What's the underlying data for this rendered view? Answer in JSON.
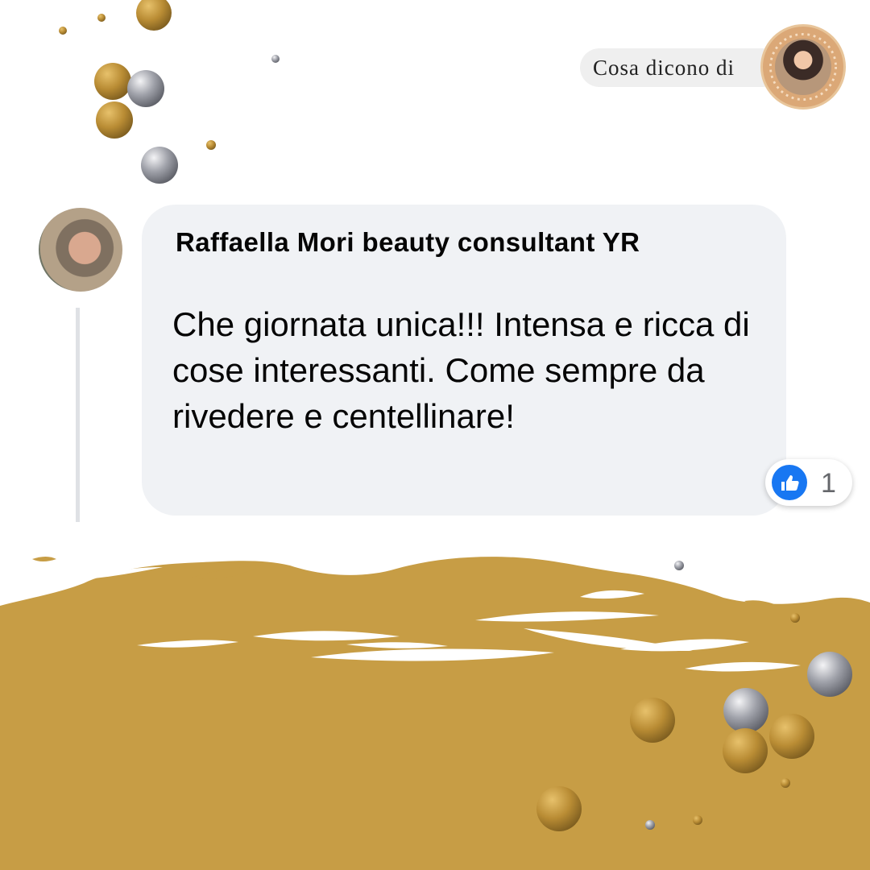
{
  "header": {
    "label": "Cosa dicono di",
    "brand_badge_icon": "brand-logo-icon"
  },
  "comment": {
    "author": "Raffaella Mori beauty consultant YR",
    "text": "Che giornata unica!!! Intensa e ricca di cose interessanti. Come sempre da rivedere e centellinare!",
    "reaction_icon": "like-icon",
    "reaction_count": "1"
  },
  "theme": {
    "gold": "#c79d45",
    "silver": "#8d9098",
    "bubble": "#f0f2f5",
    "like_blue": "#1877f2"
  }
}
